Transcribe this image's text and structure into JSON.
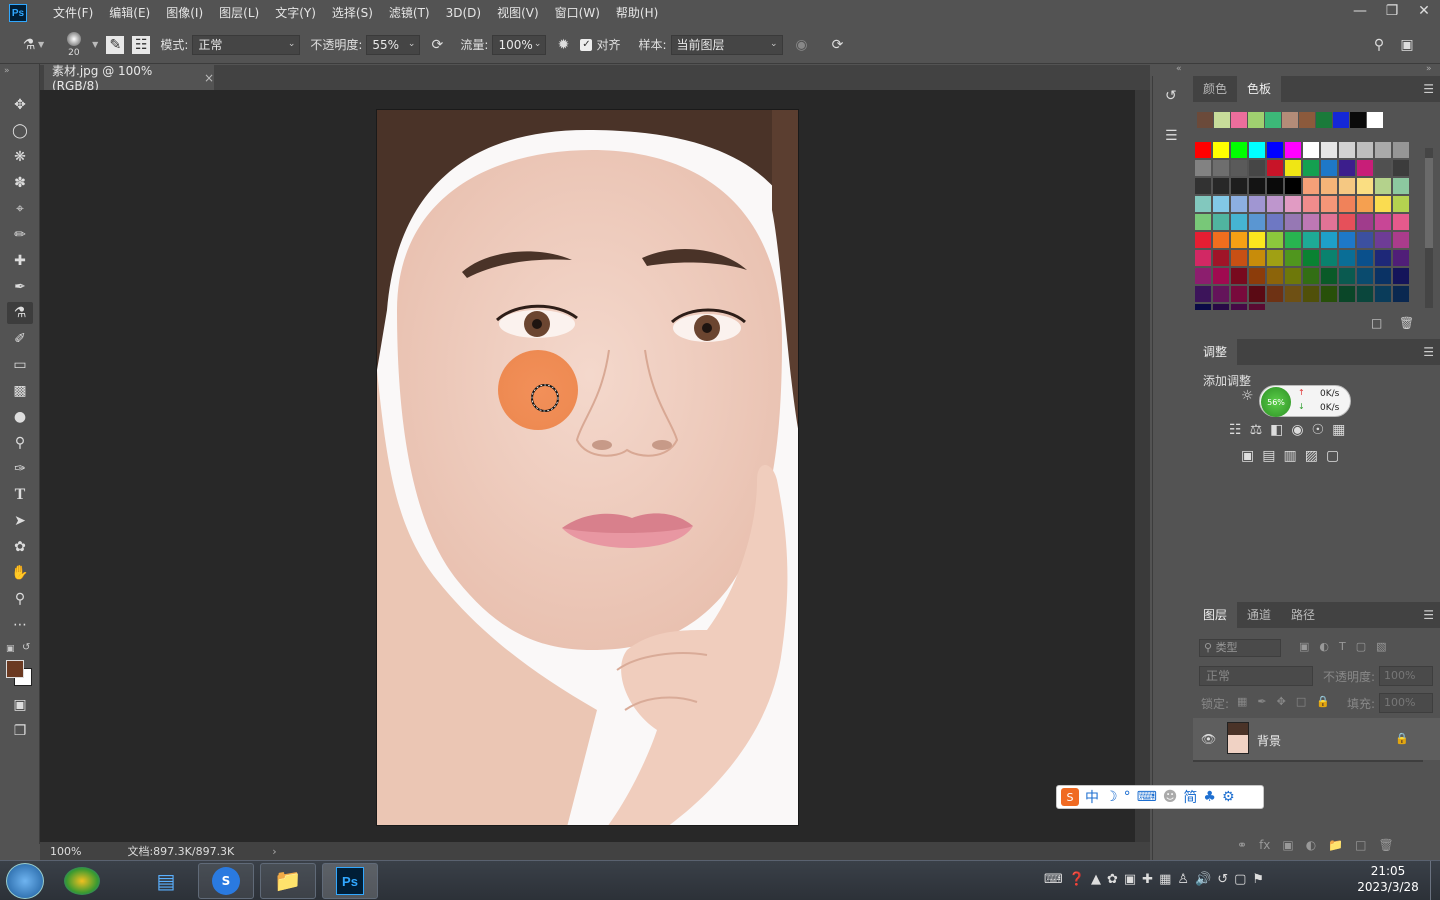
{
  "app": {
    "logo": "Ps"
  },
  "menu": [
    "文件(F)",
    "编辑(E)",
    "图像(I)",
    "图层(L)",
    "文字(Y)",
    "选择(S)",
    "滤镜(T)",
    "3D(D)",
    "视图(V)",
    "窗口(W)",
    "帮助(H)"
  ],
  "options": {
    "brush_size": "20",
    "mode_label": "模式:",
    "mode_value": "正常",
    "opacity_label": "不透明度:",
    "opacity_value": "55%",
    "flow_label": "流量:",
    "flow_value": "100%",
    "align_label": "对齐",
    "align_checked": true,
    "sample_label": "样本:",
    "sample_value": "当前图层"
  },
  "document": {
    "tab_title": "素材.jpg @ 100%(RGB/8)",
    "close": "×"
  },
  "status": {
    "zoom": "100%",
    "doc_info": "文档:897.3K/897.3K",
    "arrow": "›"
  },
  "swatches_panel": {
    "tabs": [
      "颜色",
      "色板"
    ],
    "active_tab": "色板",
    "recent_colors": [
      "#6b4a3a",
      "#c8dc9a",
      "#ec6e9c",
      "#a0d070",
      "#3cb878",
      "#b48c78",
      "#8c5a3c",
      "#1a7a3a",
      "#1428d8",
      "#0a0a0a",
      "#ffffff"
    ],
    "grid_colors": [
      "#ff0000",
      "#ffff00",
      "#00ff00",
      "#00ffff",
      "#0000ff",
      "#ff00ff",
      "#ffffff",
      "#e6e6e6",
      "#d2d2d2",
      "#bebebe",
      "#aaaaaa",
      "#969696",
      "#828282",
      "#6e6e6e",
      "#5a5a5a",
      "#464646",
      "#c81428",
      "#f0e614",
      "#14a050",
      "#1e78c8",
      "#3c1e8c",
      "#c81e78",
      "#505050",
      "#3c3c3c",
      "#323232",
      "#282828",
      "#1e1e1e",
      "#141414",
      "#0a0a0a",
      "#000000",
      "#f5a078",
      "#f5b478",
      "#f5c882",
      "#fade82",
      "#b4d28c",
      "#8cc8a0",
      "#82c8be",
      "#82c8e6",
      "#8cafe1",
      "#a096d2",
      "#be96cd",
      "#e19bc3",
      "#f08c8c",
      "#f59678",
      "#f0825a",
      "#f5a050",
      "#fadc50",
      "#b4d250",
      "#78c878",
      "#50b4a0",
      "#46b4d2",
      "#5a96d2",
      "#6e78c3",
      "#9678b4",
      "#be78b4",
      "#e17396",
      "#e6505a",
      "#a03c8c",
      "#c84696",
      "#e65a8c",
      "#e61e32",
      "#f06e1e",
      "#f5a014",
      "#fae61e",
      "#8cc83c",
      "#28b450",
      "#1eaa96",
      "#1ea0c8",
      "#1e78c8",
      "#3c50a0",
      "#6e3c96",
      "#aa3c8c",
      "#d22864",
      "#a01428",
      "#c85014",
      "#c88c0a",
      "#a0a014",
      "#50961e",
      "#0a8232",
      "#0a826e",
      "#0a6e96",
      "#0a508c",
      "#1e2878",
      "#501e78",
      "#8c1e6e",
      "#a00a50",
      "#780a1e",
      "#8c3c0a",
      "#8c640a",
      "#6e780a",
      "#326e14",
      "#0a5a28",
      "#0a5a50",
      "#0a4b6e",
      "#0a3264",
      "#14145a",
      "#3c145a",
      "#64145a",
      "#780a3c",
      "#5a0a14",
      "#6e3214",
      "#6e5014",
      "#50500a",
      "#28500a",
      "#0a4628",
      "#0a463c",
      "#0a3c5a",
      "#0a2850",
      "#0a0a46",
      "#280a46",
      "#460a46",
      "#5a0a32"
    ]
  },
  "adjustments_panel": {
    "title": "调整",
    "add_label": "添加调整",
    "net_percent": "56%",
    "net_up": "0K/s",
    "net_down": "0K/s"
  },
  "layers_panel": {
    "tabs": [
      "图层",
      "通道",
      "路径"
    ],
    "filter_placeholder": "类型",
    "blend_mode": "正常",
    "opacity_label": "不透明度:",
    "opacity_value": "100%",
    "lock_label": "锁定:",
    "fill_label": "填充:",
    "fill_value": "100%",
    "layer_name": "背景"
  },
  "ime": {
    "items": [
      "中",
      "简"
    ]
  },
  "taskbar": {
    "time": "21:05",
    "date": "2023/3/28"
  },
  "colors": {
    "foreground": "#6b3a22",
    "background": "#ffffff",
    "brush_overlay": "#f08040"
  }
}
